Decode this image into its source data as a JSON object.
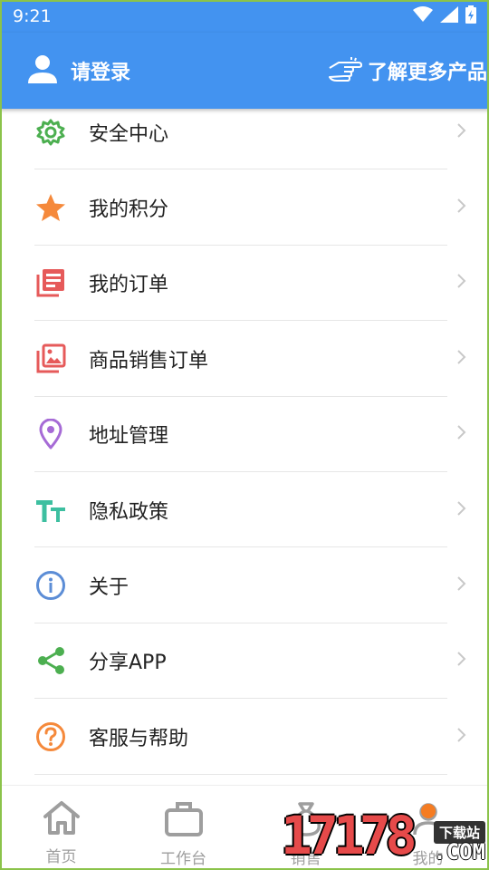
{
  "status_bar": {
    "time": "9:21"
  },
  "header": {
    "login_label": "请登录",
    "more_label": "了解更多产品",
    "background_color": "#4393F0"
  },
  "menu": [
    {
      "label": "安全中心",
      "icon": "gear-icon",
      "color": "#4CAF50"
    },
    {
      "label": "我的积分",
      "icon": "star-icon",
      "color": "#F5893B"
    },
    {
      "label": "我的订单",
      "icon": "order-list-icon",
      "color": "#E65A5A"
    },
    {
      "label": "商品销售订单",
      "icon": "gallery-icon",
      "color": "#E65A5A"
    },
    {
      "label": "地址管理",
      "icon": "location-pin-icon",
      "color": "#A66BD6"
    },
    {
      "label": "隐私政策",
      "icon": "text-size-icon",
      "color": "#3DBFA0"
    },
    {
      "label": "关于",
      "icon": "info-icon",
      "color": "#5C8DD6"
    },
    {
      "label": "分享APP",
      "icon": "share-icon",
      "color": "#4CAF50"
    },
    {
      "label": "客服与帮助",
      "icon": "help-icon",
      "color": "#F5893B"
    }
  ],
  "tabs": [
    {
      "label": "首页",
      "icon": "home-icon"
    },
    {
      "label": "工作台",
      "icon": "briefcase-icon"
    },
    {
      "label": "销售",
      "icon": "sales-icon"
    },
    {
      "label": "我的",
      "icon": "profile-icon"
    }
  ],
  "watermark": {
    "number": "17178",
    "tag": "下载站",
    "suffix": ".COM"
  }
}
